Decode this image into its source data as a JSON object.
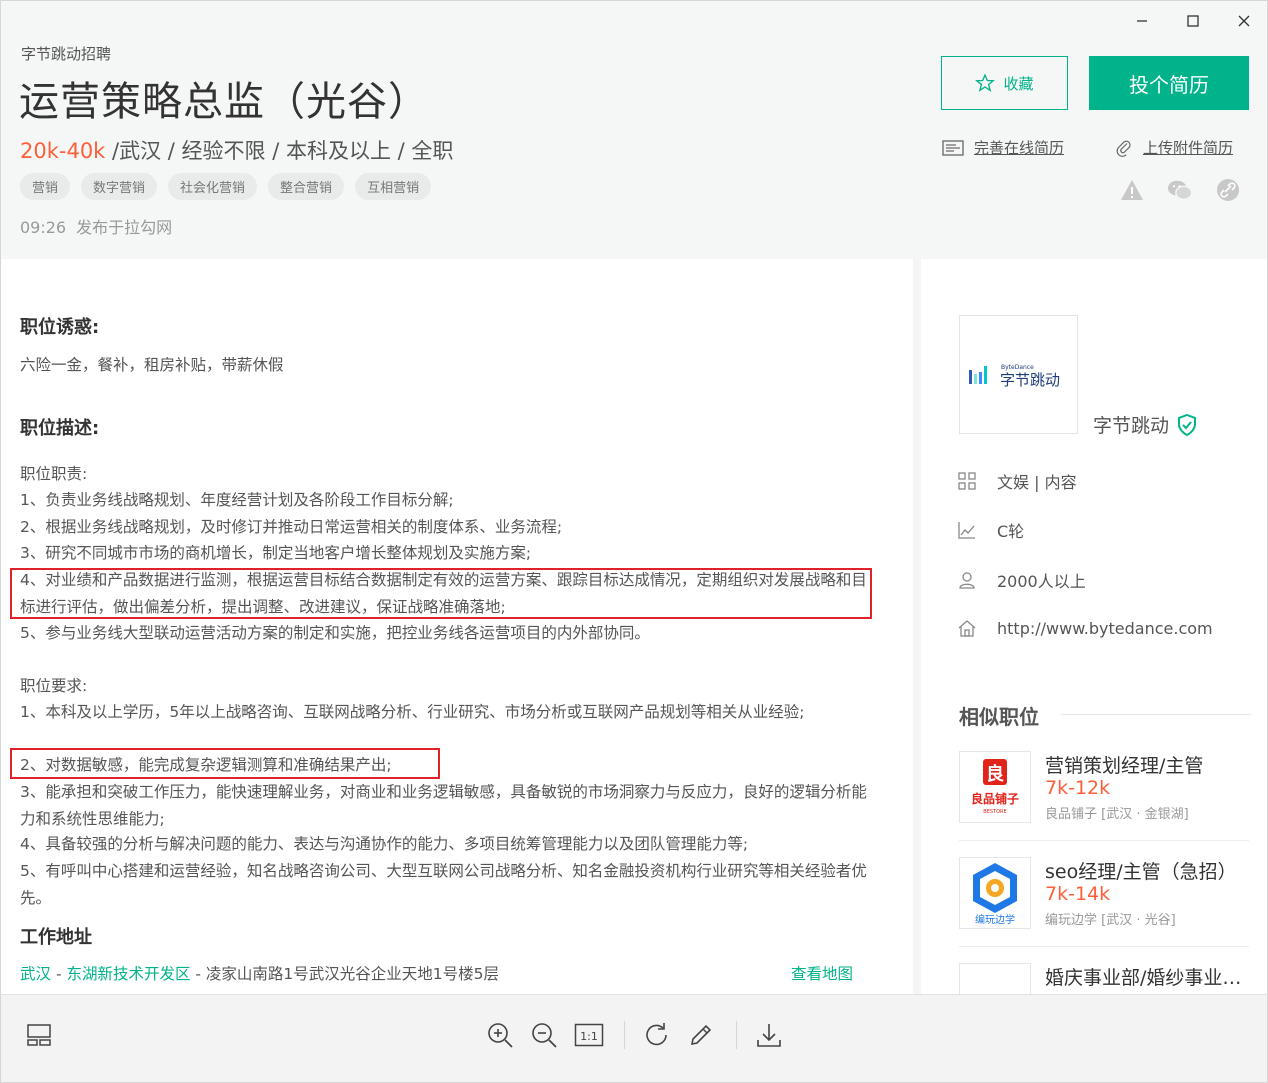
{
  "window": {
    "minimize_label": "–",
    "maximize_label": "□",
    "close_label": "×"
  },
  "header": {
    "company_small": "字节跳动招聘",
    "title": "运营策略总监（光谷）",
    "salary": "20k-40k",
    "meta": " /武汉 / 经验不限 / 本科及以上 / 全职",
    "tags": [
      "营销",
      "数字营销",
      "社会化营销",
      "整合营销",
      "互相营销"
    ],
    "time": "09:26",
    "published": "发布于拉勾网",
    "fav_label": "收藏",
    "apply_label": "投个简历",
    "resume_online": "完善在线简历",
    "resume_attach": "上传附件简历"
  },
  "main": {
    "perks_title": "职位诱惑:",
    "perks": "六险一金，餐补，租房补贴，带薪休假",
    "desc_title": "职位描述:",
    "duty_title": "职位职责:",
    "duties": [
      "1、负责业务线战略规划、年度经营计划及各阶段工作目标分解;",
      "2、根据业务线战略规划，及时修订并推动日常运营相关的制度体系、业务流程;",
      "3、研究不同城市市场的商机增长，制定当地客户增长整体规划及实施方案;",
      "4、对业绩和产品数据进行监测，根据运营目标结合数据制定有效的运营方案、跟踪目标达成情况，定期组织对发展战略和目标进行评估，做出偏差分析，提出调整、改进建议，保证战略准确落地;",
      "5、参与业务线大型联动运营活动方案的制定和实施，把控业务线各运营项目的内外部协同。"
    ],
    "req_title": "职位要求:",
    "reqs": [
      "1、本科及以上学历，5年以上战略咨询、互联网战略分析、行业研究、市场分析或互联网产品规划等相关从业经验;",
      "2、对数据敏感，能完成复杂逻辑测算和准确结果产出;",
      "3、能承担和突破工作压力，能快速理解业务，对商业和业务逻辑敏感，具备敏锐的市场洞察力与反应力，良好的逻辑分析能力和系统性思维能力;",
      "4、具备较强的分析与解决问题的能力、表达与沟通协作的能力、多项目统筹管理能力以及团队管理能力等;",
      "5、有呼叫中心搭建和运营经验，知名战略咨询公司、大型互联网公司战略分析、知名金融投资机构行业研究等相关经验者优先。"
    ],
    "address_title": "工作地址",
    "addr_city": "武汉",
    "addr_district": "东湖新技术开发区",
    "addr_street": " - 凌家山南路1号武汉光谷企业天地1号楼5层",
    "addr_sep": " - ",
    "view_map": "查看地图"
  },
  "sidebar": {
    "logo_small": "ByteDance",
    "logo_text": "字节跳动",
    "company_name": "字节跳动",
    "industry": "文娱 | 内容",
    "stage": "C轮",
    "size": "2000人以上",
    "website": "http://www.bytedance.com",
    "similar_title": "相似职位",
    "similar": [
      {
        "name": "营销策划经理/主管",
        "salary": "7k-12k",
        "company": "良品铺子 [武汉 · 金银湖]",
        "logo_text": "良品铺子",
        "logo_en": "BESTORE"
      },
      {
        "name": "seo经理/主管（急招）",
        "salary": "7k-14k",
        "company": "编玩边学 [武汉 · 光谷]",
        "logo_text": "编玩边学"
      },
      {
        "name": "婚庆事业部/婚纱事业部经理",
        "salary": "",
        "company": ""
      }
    ]
  },
  "colors": {
    "accent": "#00b38a",
    "salary": "#fd5f39",
    "highlight": "#e0232b"
  }
}
